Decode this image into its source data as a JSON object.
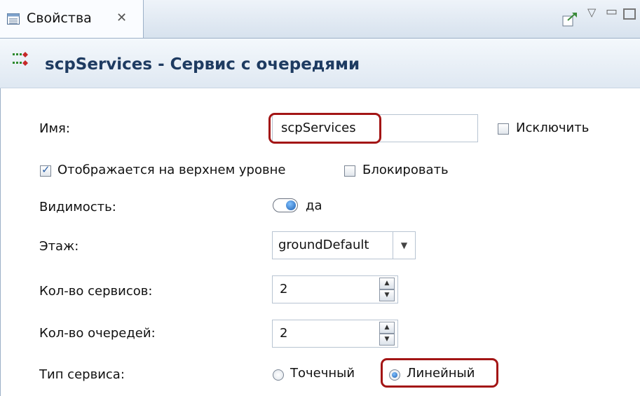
{
  "tab": {
    "icon": "properties-icon",
    "label": "Свойства",
    "close": "✕"
  },
  "toolbar": {
    "pin_icon": "pin-icon",
    "menu": "▽",
    "minimize": "▭"
  },
  "title": {
    "icon": "queue-service-icon",
    "text": "scpServices - Сервис с очередями"
  },
  "form": {
    "name_label": "Имя:",
    "name_value": "scpServices",
    "exclude_label": "Исключить",
    "exclude_checked": false,
    "show_top_label": "Отображается на верхнем уровне",
    "show_top_checked": true,
    "lock_label": "Блокировать",
    "lock_checked": false,
    "visibility_label": "Видимость:",
    "visibility_value": "да",
    "floor_label": "Этаж:",
    "floor_value": "groundDefault",
    "services_label": "Кол-во сервисов:",
    "services_value": "2",
    "queues_label": "Кол-во очередей:",
    "queues_value": "2",
    "service_type_label": "Тип сервиса:",
    "service_type_options": [
      "Точечный",
      "Линейный"
    ],
    "service_type_selected": "Линейный"
  },
  "colors": {
    "highlight": "#a31515",
    "title_text": "#1e3b61",
    "accent": "#1e5fb0"
  }
}
